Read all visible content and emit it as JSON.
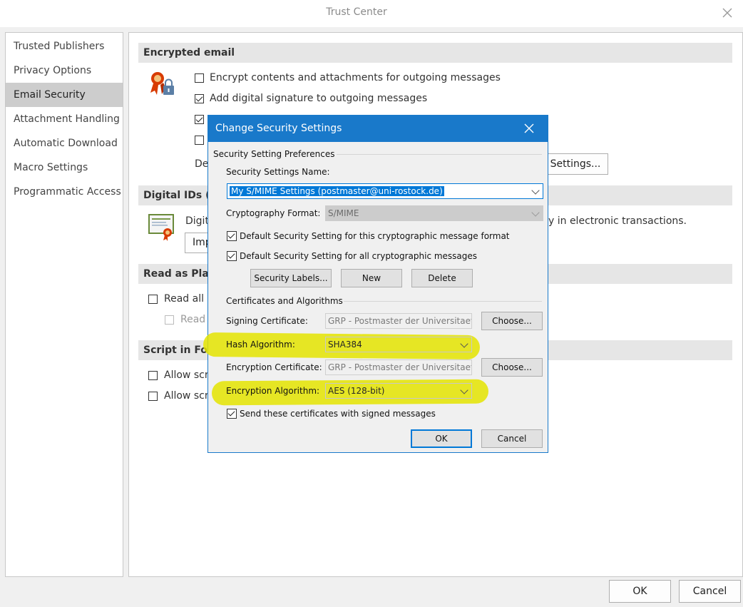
{
  "window": {
    "title": "Trust Center"
  },
  "sidebar": {
    "items": [
      {
        "label": "Trusted Publishers"
      },
      {
        "label": "Privacy Options"
      },
      {
        "label": "Email Security"
      },
      {
        "label": "Attachment Handling"
      },
      {
        "label": "Automatic Download"
      },
      {
        "label": "Macro Settings"
      },
      {
        "label": "Programmatic Access"
      }
    ],
    "selected": "Email Security"
  },
  "main": {
    "encrypted_email": {
      "header": "Encrypted email",
      "option1": "Encrypt contents and attachments for outgoing messages",
      "option2": "Add digital signature to outgoing messages",
      "default_label": "De",
      "settings_button": "Settings..."
    },
    "digital_ids": {
      "header": "Digital IDs (C",
      "text_left": "Digit",
      "text_right": "y in electronic transactions.",
      "import_button": "Imp"
    },
    "read_plain": {
      "header": "Read as Plain",
      "option1": "Read all s",
      "option2": "Read"
    },
    "script_folders": {
      "header": "Script in Fold",
      "option1": "Allow scr",
      "option2": "Allow scr"
    }
  },
  "footer": {
    "ok_label": "OK",
    "cancel_label": "Cancel"
  },
  "dialog": {
    "title": "Change Security Settings",
    "preferences_group": "Security Setting Preferences",
    "settings_name_label": "Security Settings Name:",
    "settings_name_value": "My S/MIME Settings (postmaster@uni-rostock.de)",
    "crypto_format_label": "Cryptography Format:",
    "crypto_format_value": "S/MIME",
    "default_format_label": "Default Security Setting for this cryptographic message format",
    "default_all_label": "Default Security Setting for all cryptographic messages",
    "security_labels_button": "Security Labels...",
    "new_button": "New",
    "delete_button": "Delete",
    "certs_group": "Certificates and Algorithms",
    "signing_cert_label": "Signing Certificate:",
    "signing_cert_value": "GRP - Postmaster der Universitaet",
    "choose_label": "Choose...",
    "hash_label": "Hash Algorithm:",
    "hash_value": "SHA384",
    "enc_cert_label": "Encryption Certificate:",
    "enc_cert_value": "GRP - Postmaster der Universitaet",
    "enc_alg_label": "Encryption Algorithm:",
    "enc_alg_value": "AES (128-bit)",
    "send_certs_label": "Send these certificates with signed messages",
    "ok_label": "OK",
    "cancel_label": "Cancel"
  },
  "colors": {
    "dialog_accent": "#1979ca",
    "highlight": "#e4e400",
    "selection": "#0078d7"
  }
}
